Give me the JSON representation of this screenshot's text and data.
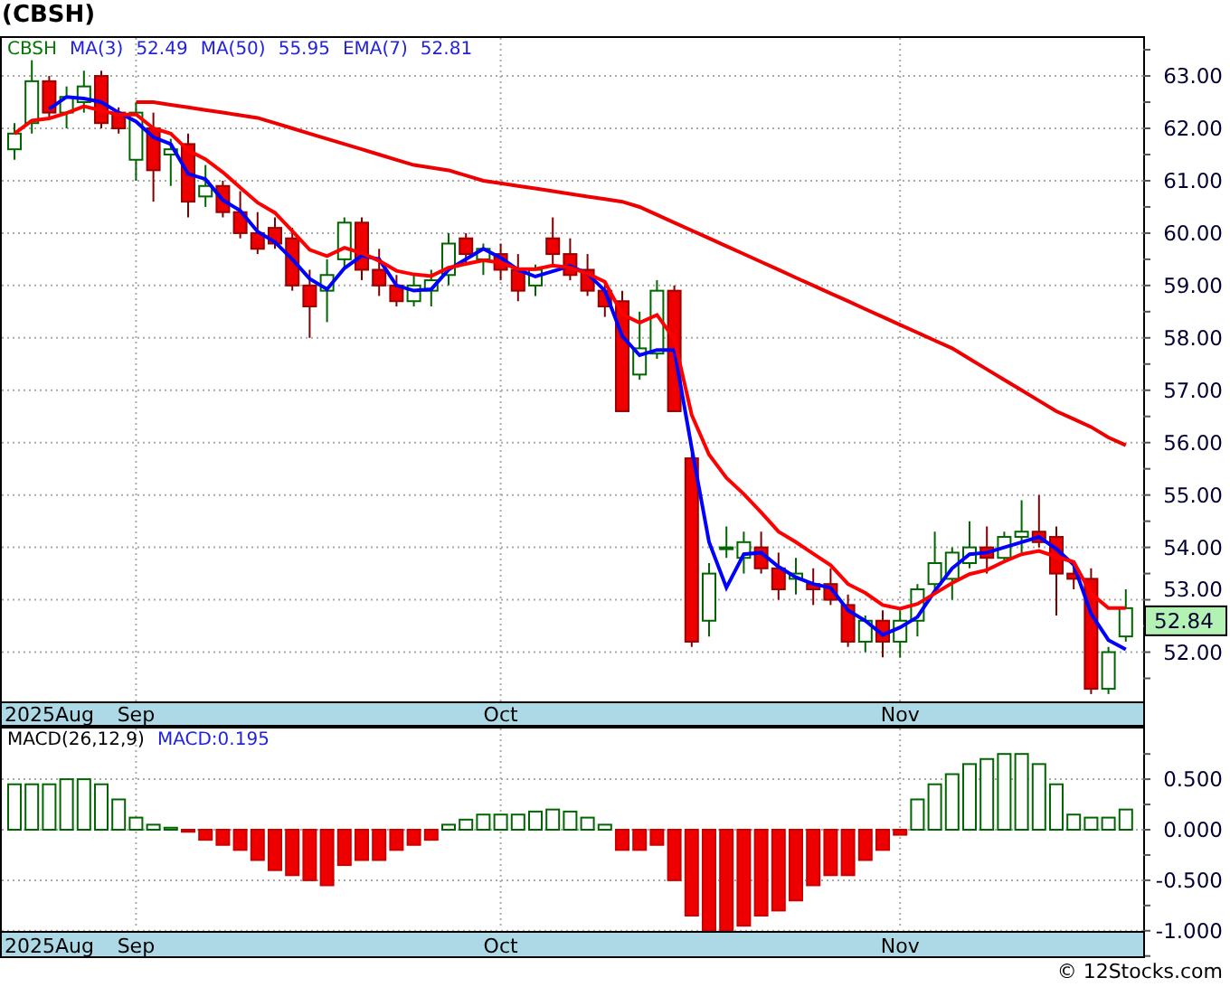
{
  "title": "(CBSH)",
  "price_panel": {
    "symbol": "CBSH",
    "legend_values": [
      "52.49",
      "55.95",
      "52.81"
    ],
    "last_price": "52.84",
    "chart_data": {
      "type": "candlestick",
      "grid": true,
      "ylim": [
        51.06,
        63.76
      ],
      "ohlc": [
        [
          61.6,
          62.1,
          61.4,
          61.9
        ],
        [
          62.1,
          63.3,
          61.9,
          62.9
        ],
        [
          62.9,
          63.0,
          62.2,
          62.3
        ],
        [
          62.3,
          62.8,
          62.0,
          62.6
        ],
        [
          62.5,
          63.1,
          62.3,
          62.8
        ],
        [
          63.0,
          63.1,
          62.0,
          62.1
        ],
        [
          62.3,
          62.4,
          61.9,
          62.0
        ],
        [
          61.4,
          62.5,
          61.0,
          62.3
        ],
        [
          62.0,
          62.3,
          60.6,
          61.2
        ],
        [
          61.5,
          61.8,
          60.9,
          61.6
        ],
        [
          61.7,
          61.9,
          60.3,
          60.6
        ],
        [
          60.7,
          61.3,
          60.5,
          60.9
        ],
        [
          60.9,
          61.0,
          60.3,
          60.4
        ],
        [
          60.4,
          60.8,
          59.9,
          60.0
        ],
        [
          60.0,
          60.4,
          59.6,
          59.7
        ],
        [
          60.1,
          60.3,
          59.7,
          59.8
        ],
        [
          59.9,
          60.1,
          58.9,
          59.0
        ],
        [
          59.0,
          59.3,
          58.0,
          58.6
        ],
        [
          58.9,
          59.5,
          58.3,
          59.2
        ],
        [
          59.5,
          60.3,
          59.3,
          60.2
        ],
        [
          60.2,
          60.3,
          59.1,
          59.3
        ],
        [
          59.3,
          59.7,
          58.8,
          59.0
        ],
        [
          59.0,
          59.2,
          58.6,
          58.7
        ],
        [
          58.7,
          59.2,
          58.6,
          59.0
        ],
        [
          58.9,
          59.3,
          58.6,
          59.1
        ],
        [
          59.2,
          60.0,
          59.0,
          59.8
        ],
        [
          59.9,
          60.0,
          59.4,
          59.6
        ],
        [
          59.5,
          59.8,
          59.2,
          59.7
        ],
        [
          59.6,
          59.8,
          59.1,
          59.3
        ],
        [
          59.3,
          59.6,
          58.7,
          58.9
        ],
        [
          59.0,
          59.4,
          58.8,
          59.3
        ],
        [
          59.9,
          60.3,
          59.4,
          59.6
        ],
        [
          59.6,
          59.9,
          59.1,
          59.2
        ],
        [
          59.3,
          59.6,
          58.8,
          58.9
        ],
        [
          58.9,
          59.1,
          58.4,
          58.6
        ],
        [
          58.7,
          58.9,
          56.6,
          56.6
        ],
        [
          57.3,
          58.5,
          57.2,
          57.8
        ],
        [
          57.7,
          59.1,
          57.6,
          58.9
        ],
        [
          58.9,
          59.0,
          56.6,
          56.6
        ],
        [
          55.7,
          55.8,
          52.1,
          52.2
        ],
        [
          52.6,
          53.7,
          52.3,
          53.5
        ],
        [
          54.0,
          54.4,
          53.8,
          54.0
        ],
        [
          53.8,
          54.3,
          53.5,
          54.1
        ],
        [
          54.0,
          54.3,
          53.5,
          53.6
        ],
        [
          53.6,
          53.9,
          53.0,
          53.2
        ],
        [
          53.4,
          53.8,
          53.1,
          53.5
        ],
        [
          53.3,
          53.6,
          52.9,
          53.2
        ],
        [
          53.3,
          53.6,
          52.9,
          53.0
        ],
        [
          52.9,
          53.1,
          52.1,
          52.2
        ],
        [
          52.2,
          52.7,
          52.0,
          52.6
        ],
        [
          52.6,
          52.8,
          51.9,
          52.2
        ],
        [
          52.2,
          52.8,
          51.9,
          52.6
        ],
        [
          52.6,
          53.3,
          52.3,
          53.2
        ],
        [
          53.3,
          54.3,
          53.2,
          53.7
        ],
        [
          53.4,
          54.0,
          53.0,
          53.9
        ],
        [
          53.7,
          54.5,
          53.6,
          54.0
        ],
        [
          54.0,
          54.4,
          53.5,
          53.8
        ],
        [
          53.8,
          54.3,
          53.7,
          54.2
        ],
        [
          54.2,
          54.9,
          53.9,
          54.3
        ],
        [
          54.3,
          55.0,
          54.0,
          54.1
        ],
        [
          54.2,
          54.4,
          52.7,
          53.5
        ],
        [
          53.5,
          53.7,
          53.2,
          53.4
        ],
        [
          53.4,
          53.6,
          51.2,
          51.3
        ],
        [
          51.3,
          52.1,
          51.2,
          52.0
        ],
        [
          52.3,
          53.2,
          52.2,
          52.84
        ]
      ],
      "categories": [
        null,
        null,
        "2025Aug",
        null,
        null,
        null,
        null,
        "Sep",
        null,
        null,
        null,
        null,
        null,
        null,
        null,
        null,
        null,
        null,
        null,
        null,
        null,
        null,
        null,
        null,
        null,
        null,
        null,
        null,
        "Oct",
        null,
        null,
        null,
        null,
        null,
        null,
        null,
        null,
        null,
        null,
        null,
        null,
        null,
        null,
        null,
        null,
        null,
        null,
        null,
        null,
        null,
        null,
        "Nov",
        null,
        null,
        null,
        null,
        null,
        null,
        null,
        null,
        null,
        null,
        null,
        null,
        null
      ],
      "yticks": [
        {
          "value": 52,
          "label": "52.00"
        },
        {
          "value": 53,
          "label": "53.00"
        },
        {
          "value": 54,
          "label": "54.00"
        },
        {
          "value": 55,
          "label": "55.00"
        },
        {
          "value": 56,
          "label": "56.00"
        },
        {
          "value": 57,
          "label": "57.00"
        },
        {
          "value": 58,
          "label": "58.00"
        },
        {
          "value": 59,
          "label": "59.00"
        },
        {
          "value": 60,
          "label": "60.00"
        },
        {
          "value": 61,
          "label": "61.00"
        },
        {
          "value": 62,
          "label": "62.00"
        },
        {
          "value": 63,
          "label": "63.00"
        }
      ],
      "series": [
        {
          "name": "MA(3)",
          "type": "line",
          "color": "#0000ff",
          "values": [
            null,
            null,
            62.37,
            62.6,
            62.57,
            62.5,
            62.3,
            62.13,
            61.83,
            61.7,
            61.13,
            61.03,
            60.63,
            60.43,
            60.03,
            59.83,
            59.5,
            59.13,
            58.93,
            59.33,
            59.57,
            59.5,
            59.0,
            58.9,
            58.93,
            59.3,
            59.5,
            59.7,
            59.53,
            59.3,
            59.17,
            59.27,
            59.37,
            59.23,
            58.9,
            58.03,
            57.67,
            57.77,
            57.77,
            55.9,
            54.1,
            53.23,
            53.87,
            53.9,
            53.63,
            53.43,
            53.3,
            53.23,
            52.8,
            52.6,
            52.33,
            52.47,
            52.67,
            53.17,
            53.6,
            53.87,
            53.9,
            54.0,
            54.1,
            54.2,
            53.97,
            53.67,
            52.73,
            52.23,
            52.05
          ]
        },
        {
          "name": "MA(50)",
          "type": "line",
          "color": "#ee0000",
          "values": [
            null,
            null,
            null,
            null,
            null,
            null,
            null,
            62.5,
            62.5,
            62.45,
            62.4,
            62.35,
            62.3,
            62.25,
            62.2,
            62.1,
            62.0,
            61.9,
            61.8,
            61.7,
            61.6,
            61.5,
            61.4,
            61.3,
            61.25,
            61.2,
            61.1,
            61.0,
            60.95,
            60.9,
            60.85,
            60.8,
            60.75,
            60.7,
            60.65,
            60.6,
            60.5,
            60.35,
            60.2,
            60.05,
            59.9,
            59.75,
            59.6,
            59.45,
            59.3,
            59.15,
            59.0,
            58.85,
            58.7,
            58.55,
            58.4,
            58.25,
            58.1,
            57.95,
            57.8,
            57.6,
            57.4,
            57.2,
            57.0,
            56.8,
            56.6,
            56.45,
            56.3,
            56.1,
            55.95
          ]
        },
        {
          "name": "EMA(7)",
          "type": "line",
          "color": "#ff0000",
          "values": [
            61.9,
            62.15,
            62.19,
            62.29,
            62.42,
            62.34,
            62.26,
            62.27,
            62.0,
            61.9,
            61.58,
            61.41,
            61.16,
            60.87,
            60.58,
            60.39,
            60.04,
            59.68,
            59.56,
            59.72,
            59.62,
            59.47,
            59.28,
            59.21,
            59.18,
            59.34,
            59.41,
            59.48,
            59.44,
            59.31,
            59.31,
            59.38,
            59.34,
            59.23,
            59.07,
            58.45,
            58.29,
            58.44,
            57.98,
            56.53,
            55.77,
            55.33,
            55.02,
            54.67,
            54.3,
            54.1,
            53.88,
            53.66,
            53.3,
            53.13,
            52.9,
            52.83,
            52.92,
            53.12,
            53.32,
            53.49,
            53.57,
            53.73,
            53.87,
            53.93,
            53.82,
            53.72,
            53.12,
            52.84,
            52.84
          ]
        }
      ]
    }
  },
  "macd_panel": {
    "legend": [
      {
        "text": "MACD(26,12,9)",
        "kind": "name"
      },
      {
        "text": "MACD:0.195",
        "kind": "value"
      }
    ],
    "chart_data": {
      "type": "bar",
      "grid": true,
      "ylim": [
        -1.02,
        1.02
      ],
      "categories": [
        null,
        null,
        "2025Aug",
        null,
        null,
        null,
        null,
        "Sep",
        null,
        null,
        null,
        null,
        null,
        null,
        null,
        null,
        null,
        null,
        null,
        null,
        null,
        null,
        null,
        null,
        null,
        null,
        null,
        null,
        "Oct",
        null,
        null,
        null,
        null,
        null,
        null,
        null,
        null,
        null,
        null,
        null,
        null,
        null,
        null,
        null,
        null,
        null,
        null,
        null,
        null,
        null,
        null,
        "Nov",
        null,
        null,
        null,
        null,
        null,
        null,
        null,
        null,
        null,
        null,
        null,
        null,
        null
      ],
      "yticks": [
        {
          "value": 0.5,
          "label": "0.500"
        },
        {
          "value": 0,
          "label": "0.000"
        },
        {
          "value": -0.5,
          "label": "-0.500"
        },
        {
          "value": -1,
          "label": "-1.000"
        }
      ],
      "values": [
        0.45,
        0.45,
        0.45,
        0.5,
        0.5,
        0.45,
        0.3,
        0.12,
        0.05,
        0.02,
        -0.02,
        -0.1,
        -0.15,
        -0.2,
        -0.3,
        -0.4,
        -0.45,
        -0.5,
        -0.55,
        -0.35,
        -0.3,
        -0.3,
        -0.2,
        -0.15,
        -0.1,
        0.05,
        0.1,
        0.15,
        0.15,
        0.15,
        0.18,
        0.2,
        0.18,
        0.12,
        0.05,
        -0.2,
        -0.2,
        -0.15,
        -0.5,
        -0.85,
        -1.0,
        -1.0,
        -0.95,
        -0.85,
        -0.8,
        -0.7,
        -0.55,
        -0.45,
        -0.45,
        -0.3,
        -0.2,
        -0.05,
        0.3,
        0.45,
        0.55,
        0.65,
        0.7,
        0.75,
        0.75,
        0.65,
        0.45,
        0.15,
        0.12,
        0.12,
        0.2
      ]
    }
  },
  "footer": "© 12Stocks.com"
}
